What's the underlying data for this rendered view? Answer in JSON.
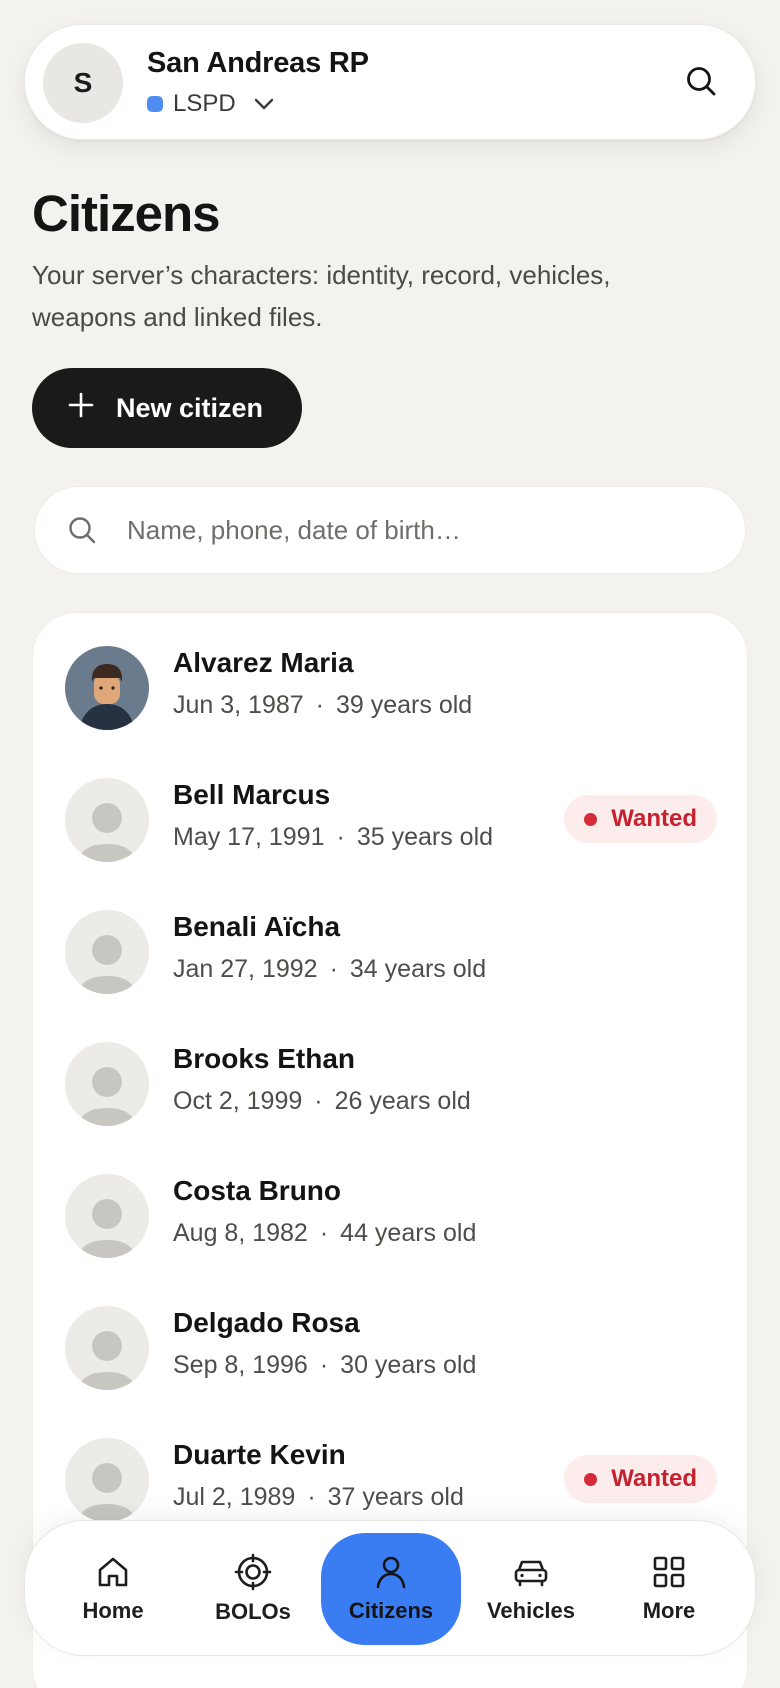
{
  "header": {
    "server_initial": "S",
    "server_name": "San Andreas RP",
    "department": "LSPD",
    "department_color": "#4f8cf0"
  },
  "page": {
    "title": "Citizens",
    "description": "Your server’s characters: identity, record, vehicles, weapons and linked files.",
    "new_button_label": "New citizen"
  },
  "search": {
    "placeholder": "Name, phone, date of birth…",
    "value": ""
  },
  "citizens": [
    {
      "name": "Alvarez Maria",
      "dob": "Jun 3, 1987",
      "age": "39 years old",
      "badge": ""
    },
    {
      "name": "Bell Marcus",
      "dob": "May 17, 1991",
      "age": "35 years old",
      "badge": "Wanted"
    },
    {
      "name": "Benali Aïcha",
      "dob": "Jan 27, 1992",
      "age": "34 years old",
      "badge": ""
    },
    {
      "name": "Brooks Ethan",
      "dob": "Oct 2, 1999",
      "age": "26 years old",
      "badge": ""
    },
    {
      "name": "Costa Bruno",
      "dob": "Aug 8, 1982",
      "age": "44 years old",
      "badge": ""
    },
    {
      "name": "Delgado Rosa",
      "dob": "Sep 8, 1996",
      "age": "30 years old",
      "badge": ""
    },
    {
      "name": "Duarte Kevin",
      "dob": "Jul 2, 1989",
      "age": "37 years old",
      "badge": "Wanted"
    }
  ],
  "meta_separator": "·",
  "colors": {
    "accent": "#3a7df2",
    "wanted_text": "#c4222f",
    "wanted_bg": "#fdecec"
  },
  "nav": {
    "items": [
      {
        "label": "Home",
        "icon": "home-icon"
      },
      {
        "label": "BOLOs",
        "icon": "target-icon"
      },
      {
        "label": "Citizens",
        "icon": "person-icon",
        "active": true
      },
      {
        "label": "Vehicles",
        "icon": "car-icon"
      },
      {
        "label": "More",
        "icon": "grid-icon"
      }
    ]
  }
}
